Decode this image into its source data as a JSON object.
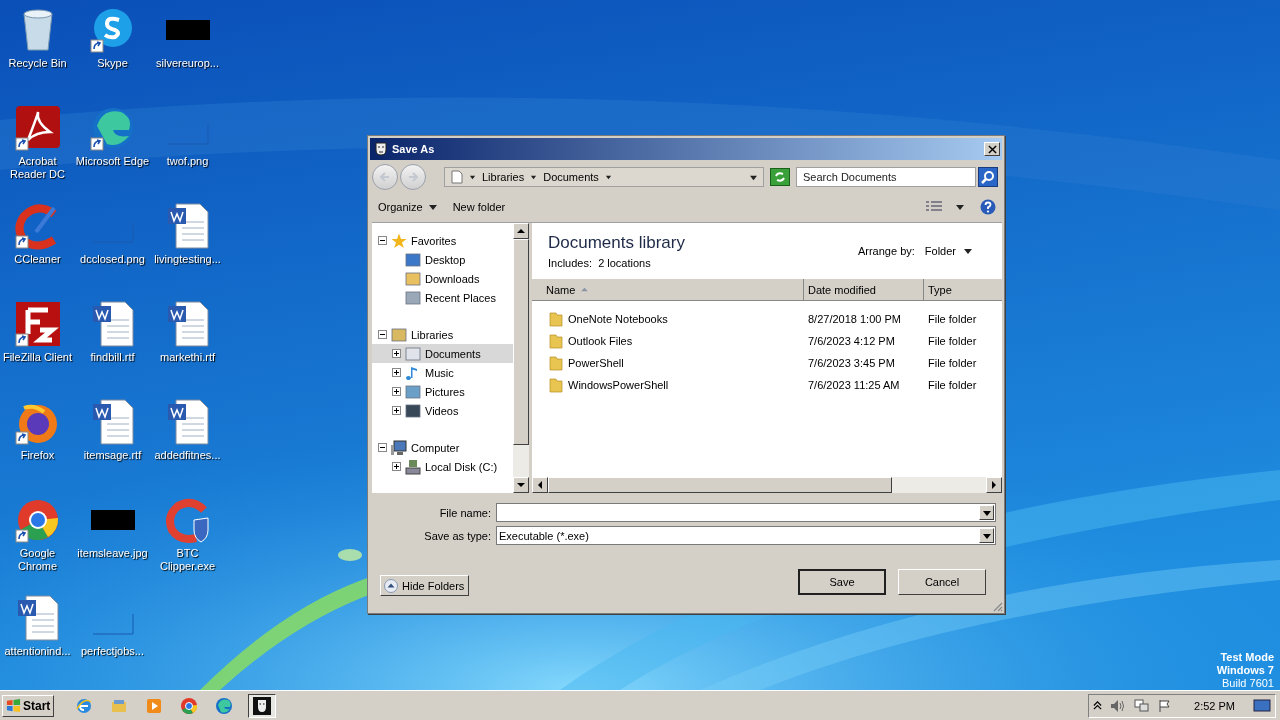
{
  "desktop_icons": [
    {
      "label": "Recycle Bin",
      "kind": "recycle",
      "shortcut": false
    },
    {
      "label": "Acrobat Reader DC",
      "kind": "acrobat",
      "shortcut": true
    },
    {
      "label": "CCleaner",
      "kind": "ccleaner",
      "shortcut": true
    },
    {
      "label": "FileZilla Client",
      "kind": "filezilla",
      "shortcut": true
    },
    {
      "label": "Firefox",
      "kind": "firefox",
      "shortcut": true
    },
    {
      "label": "Google Chrome",
      "kind": "chrome",
      "shortcut": true
    },
    {
      "label": "attentionind...",
      "kind": "word",
      "shortcut": false
    },
    {
      "label": "Skype",
      "kind": "skype",
      "shortcut": true
    },
    {
      "label": "Microsoft Edge",
      "kind": "edge",
      "shortcut": true
    },
    {
      "label": "dcclosed.png",
      "kind": "thumb",
      "shortcut": false
    },
    {
      "label": "findbill.rtf",
      "kind": "word",
      "shortcut": false
    },
    {
      "label": "itemsage.rtf",
      "kind": "word",
      "shortcut": false
    },
    {
      "label": "itemsleave.jpg",
      "kind": "black",
      "shortcut": false
    },
    {
      "label": "perfectjobs...",
      "kind": "thumb",
      "shortcut": false
    },
    {
      "label": "silvereurop...",
      "kind": "black",
      "shortcut": false
    },
    {
      "label": "twof.png",
      "kind": "thumb",
      "shortcut": false
    },
    {
      "label": "livingtesting...",
      "kind": "word",
      "shortcut": false
    },
    {
      "label": "markethi.rtf",
      "kind": "word",
      "shortcut": false
    },
    {
      "label": "addedfitnes...",
      "kind": "word",
      "shortcut": false
    },
    {
      "label": "BTC Clipper.exe",
      "kind": "shield",
      "shortcut": false
    }
  ],
  "dialog": {
    "title": "Save As",
    "breadcrumb": [
      "Libraries",
      "Documents"
    ],
    "search": {
      "placeholder": "Search Documents"
    },
    "toolbar": {
      "organize": "Organize",
      "new_folder": "New folder"
    },
    "tree": [
      {
        "label": "Favorites",
        "kind": "star",
        "expanded": true,
        "selected": false,
        "children": [
          {
            "label": "Desktop",
            "kind": "desktop",
            "selected": false
          },
          {
            "label": "Downloads",
            "kind": "downloads",
            "selected": false
          },
          {
            "label": "Recent Places",
            "kind": "recent",
            "selected": false
          }
        ]
      },
      {
        "label": "Libraries",
        "kind": "libraries",
        "expanded": true,
        "selected": false,
        "children": [
          {
            "label": "Documents",
            "kind": "documents",
            "expanded": false,
            "selected": true
          },
          {
            "label": "Music",
            "kind": "music",
            "expanded": false,
            "selected": false
          },
          {
            "label": "Pictures",
            "kind": "pictures",
            "expanded": false,
            "selected": false
          },
          {
            "label": "Videos",
            "kind": "videos",
            "expanded": false,
            "selected": false
          }
        ]
      },
      {
        "label": "Computer",
        "kind": "computer",
        "expanded": true,
        "selected": false,
        "children": [
          {
            "label": "Local Disk (C:)",
            "kind": "disk",
            "expanded": false,
            "selected": false
          }
        ]
      }
    ],
    "library": {
      "title": "Documents library",
      "includes": "Includes:  2 locations",
      "arrange_label": "Arrange by:",
      "arrange_value": "Folder"
    },
    "columns": [
      {
        "label": "Name",
        "sorted": true
      },
      {
        "label": "Date modified",
        "sorted": false
      },
      {
        "label": "Type",
        "sorted": false
      }
    ],
    "rows": [
      {
        "name": "OneNote Notebooks",
        "date": "8/27/2018 1:00 PM",
        "type": "File folder"
      },
      {
        "name": "Outlook Files",
        "date": "7/6/2023 4:12 PM",
        "type": "File folder"
      },
      {
        "name": "PowerShell",
        "date": "7/6/2023 3:45 PM",
        "type": "File folder"
      },
      {
        "name": "WindowsPowerShell",
        "date": "7/6/2023 11:25 AM",
        "type": "File folder"
      }
    ],
    "file_name": {
      "label": "File name:"
    },
    "save_as_type": {
      "label": "Save as type:",
      "value": "Executable (*.exe)"
    },
    "hide_folders": "Hide Folders",
    "buttons": [
      {
        "label": "Save",
        "default": true
      },
      {
        "label": "Cancel",
        "default": false
      }
    ]
  },
  "taskbar": {
    "start": "Start",
    "apps": [
      {
        "kind": "ie",
        "active": false
      },
      {
        "kind": "explorer",
        "active": false
      },
      {
        "kind": "media",
        "active": false
      },
      {
        "kind": "chrome",
        "active": false
      },
      {
        "kind": "edge",
        "active": false
      },
      {
        "kind": "mask",
        "active": true
      }
    ],
    "clock": "2:52 PM"
  },
  "desktop_notice": [
    "Test Mode",
    "Windows 7",
    "Build 7601"
  ]
}
